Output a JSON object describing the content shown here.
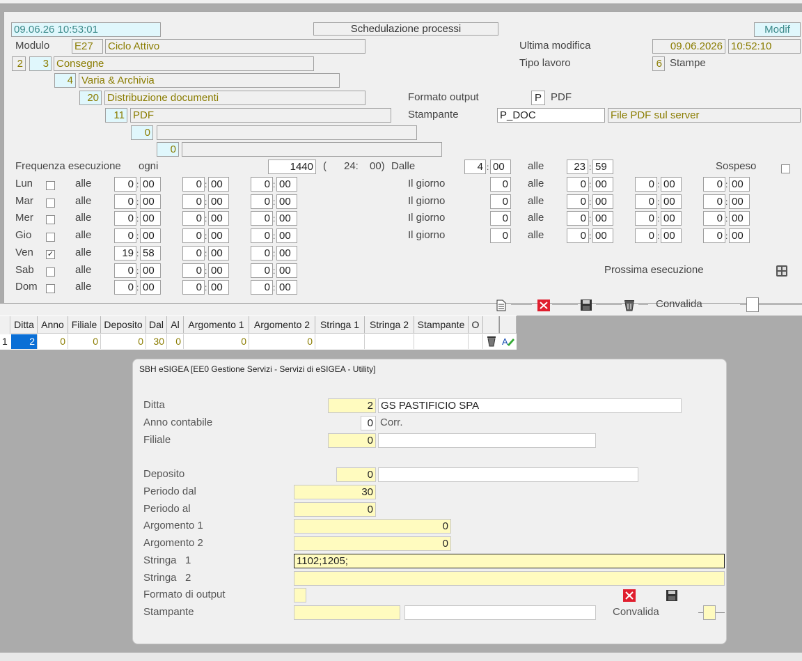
{
  "header": {
    "timestamp": "09.06.26 10:53:01",
    "title": "Schedulazione processi",
    "mode": "Modif",
    "modulo_label": "Modulo",
    "modulo_code": "E27",
    "modulo_desc": "Ciclo Attivo",
    "ultima_modifica_label": "Ultima modifica",
    "ultima_modifica_date": "09.06.2026",
    "ultima_modifica_time": "10:52:10",
    "tipo_lavoro_label": "Tipo lavoro",
    "tipo_lavoro_code": "6",
    "tipo_lavoro_desc": "Stampe",
    "formato_output_label": "Formato output",
    "formato_output_code": "P",
    "formato_output_desc": "PDF",
    "stampante_label": "Stampante",
    "stampante_value": "P_DOC",
    "stampante_desc": "File PDF sul server"
  },
  "tree": [
    {
      "a": "2",
      "b": "3",
      "label": "Consegne"
    },
    {
      "num": "4",
      "label": "Varia & Archivia"
    },
    {
      "num": "20",
      "label": "Distribuzione documenti"
    },
    {
      "num": "11",
      "label": "PDF"
    },
    {
      "num": "0",
      "label": ""
    },
    {
      "num": "0",
      "label": ""
    }
  ],
  "freq": {
    "label": "Frequenza esecuzione",
    "ogni_label": "ogni",
    "ogni_value": "1440",
    "open_paren": "(",
    "hours": "24:",
    "mins_close": "00)",
    "dalle_label": "Dalle",
    "dalle_h": "4",
    "dalle_m": "00",
    "alle_label": "alle",
    "alle_h": "23",
    "alle_m": "59",
    "sospeso_label": "Sospeso",
    "prossima_label": "Prossima esecuzione"
  },
  "alle_label": "alle",
  "il_giorno_label": "Il giorno",
  "days": [
    {
      "name": "Lun",
      "checked": "",
      "t1h": "0",
      "t1m": "00",
      "t2h": "0",
      "t2m": "00",
      "t3h": "0",
      "t3m": "00"
    },
    {
      "name": "Mar",
      "checked": "",
      "t1h": "0",
      "t1m": "00",
      "t2h": "0",
      "t2m": "00",
      "t3h": "0",
      "t3m": "00"
    },
    {
      "name": "Mer",
      "checked": "",
      "t1h": "0",
      "t1m": "00",
      "t2h": "0",
      "t2m": "00",
      "t3h": "0",
      "t3m": "00"
    },
    {
      "name": "Gio",
      "checked": "",
      "t1h": "0",
      "t1m": "00",
      "t2h": "0",
      "t2m": "00",
      "t3h": "0",
      "t3m": "00"
    },
    {
      "name": "Ven",
      "checked": "✓",
      "t1h": "19",
      "t1m": "58",
      "t2h": "0",
      "t2m": "00",
      "t3h": "0",
      "t3m": "00"
    },
    {
      "name": "Sab",
      "checked": "",
      "t1h": "0",
      "t1m": "00",
      "t2h": "0",
      "t2m": "00",
      "t3h": "0",
      "t3m": "00"
    },
    {
      "name": "Dom",
      "checked": "",
      "t1h": "0",
      "t1m": "00",
      "t2h": "0",
      "t2m": "00",
      "t3h": "0",
      "t3m": "00"
    }
  ],
  "giorno_rows": [
    {
      "g": "0",
      "t1h": "0",
      "t1m": "00",
      "t2h": "0",
      "t2m": "00",
      "t3h": "0",
      "t3m": "00"
    },
    {
      "g": "0",
      "t1h": "0",
      "t1m": "00",
      "t2h": "0",
      "t2m": "00",
      "t3h": "0",
      "t3m": "00"
    },
    {
      "g": "0",
      "t1h": "0",
      "t1m": "00",
      "t2h": "0",
      "t2m": "00",
      "t3h": "0",
      "t3m": "00"
    },
    {
      "g": "0",
      "t1h": "0",
      "t1m": "00",
      "t2h": "0",
      "t2m": "00",
      "t3h": "0",
      "t3m": "00"
    }
  ],
  "toolbar": {
    "convalida_label": "Convalida",
    "icons": [
      "new-document-icon",
      "delete-x-icon",
      "save-icon",
      "trash-icon"
    ]
  },
  "grid": {
    "headers": [
      "Ditta",
      "Anno",
      "Filiale",
      "Deposito",
      "Dal",
      "Al",
      "Argomento 1",
      "Argomento 2",
      "Stringa 1",
      "Stringa 2",
      "Stampante",
      "O"
    ],
    "row_num": "1",
    "row": [
      "2",
      "0",
      "0",
      "0",
      "30",
      "0",
      "0",
      "0",
      "",
      "",
      "",
      ""
    ]
  },
  "dialog": {
    "title": "SBH eSIGEA [EE0 Gestione Servizi - Servizi di eSIGEA - Utility]",
    "ditta_label": "Ditta",
    "ditta_value": "2",
    "ditta_desc": "GS PASTIFICIO SPA",
    "anno_label": "Anno contabile",
    "anno_value": "0",
    "anno_desc": "Corr.",
    "filiale_label": "Filiale",
    "filiale_value": "0",
    "filiale_desc": "",
    "deposito_label": "Deposito",
    "deposito_value": "0",
    "deposito_desc": "",
    "periodo_dal_label": "Periodo dal",
    "periodo_dal_value": "30",
    "periodo_al_label": "Periodo  al",
    "periodo_al_value": "0",
    "arg1_label": "Argomento 1",
    "arg1_value": "0",
    "arg2_label": "Argomento 2",
    "arg2_value": "0",
    "stringa1_label": "Stringa   1",
    "stringa1_value": "1102;1205;",
    "stringa2_label": "Stringa   2",
    "stringa2_value": "",
    "formato_label": "Formato di output",
    "formato_value": "",
    "stampante_label": "Stampante",
    "stampante_value": "",
    "stampante_desc": "",
    "convalida_label": "Convalida"
  },
  "colors": {
    "field_cyan": "#e0f7fc",
    "field_yellow": "#fffbbf",
    "value_olive": "#8a7c00",
    "teal_text": "#3b8a8a",
    "selection_blue": "#0a6fd6",
    "delete_red": "#e01e2e"
  }
}
